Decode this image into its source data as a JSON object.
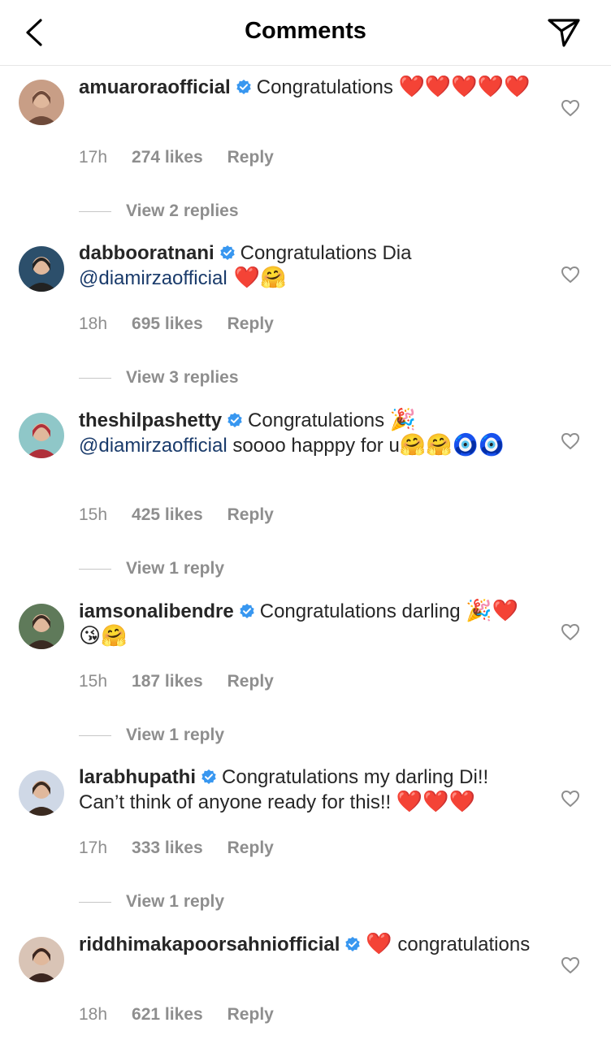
{
  "header": {
    "title": "Comments"
  },
  "comments": [
    {
      "username": "amuaroraofficial",
      "segments": [
        {
          "t": "text",
          "v": "Congratulations "
        },
        {
          "t": "emoji",
          "v": "❤️❤️❤️❤️❤️"
        }
      ],
      "time": "17h",
      "likes": "274 likes",
      "reply": "Reply",
      "view_replies": "View 2 replies",
      "avatar_colors": [
        "#c89e86",
        "#6e4a3a"
      ]
    },
    {
      "username": "dabbooratnani",
      "segments": [
        {
          "t": "text",
          "v": "Congratulations Dia "
        },
        {
          "t": "mention",
          "v": "@diamirzaofficial"
        },
        {
          "t": "emoji",
          "v": " ❤️🤗"
        }
      ],
      "time": "18h",
      "likes": "695 likes",
      "reply": "Reply",
      "view_replies": "View 3 replies",
      "avatar_colors": [
        "#2c4f6b",
        "#222222"
      ]
    },
    {
      "username": "theshilpashetty",
      "segments": [
        {
          "t": "text",
          "v": "Congratulations "
        },
        {
          "t": "emoji",
          "v": "🎉"
        },
        {
          "t": "text",
          "v": " "
        },
        {
          "t": "mention",
          "v": "@diamirzaofficial"
        },
        {
          "t": "text",
          "v": " soooo happpy for u"
        },
        {
          "t": "emoji",
          "v": "🤗🤗🧿🧿"
        }
      ],
      "time": "15h",
      "likes": "425 likes",
      "reply": "Reply",
      "view_replies": "View 1 reply",
      "avatar_colors": [
        "#8fc7c8",
        "#b0303a"
      ]
    },
    {
      "username": "iamsonalibendre",
      "segments": [
        {
          "t": "text",
          "v": "Congratulations darling "
        },
        {
          "t": "emoji",
          "v": "🎉❤️😘🤗"
        }
      ],
      "time": "15h",
      "likes": "187 likes",
      "reply": "Reply",
      "view_replies": "View 1 reply",
      "avatar_colors": [
        "#5f7a5a",
        "#3a2a22"
      ]
    },
    {
      "username": "larabhupathi",
      "segments": [
        {
          "t": "text",
          "v": "Congratulations my darling Di!! Can’t think of anyone ready for this!! "
        },
        {
          "t": "emoji",
          "v": "❤️❤️❤️"
        }
      ],
      "time": "17h",
      "likes": "333 likes",
      "reply": "Reply",
      "view_replies": "View 1 reply",
      "avatar_colors": [
        "#cfd8e6",
        "#3a2a20"
      ]
    },
    {
      "username": "riddhimakapoorsahniofficial",
      "segments": [
        {
          "t": "emoji",
          "v": "❤️"
        },
        {
          "t": "text",
          "v": " congratulations"
        }
      ],
      "time": "18h",
      "likes": "621 likes",
      "reply": "Reply",
      "view_replies": "",
      "avatar_colors": [
        "#d9c4b6",
        "#3b2620"
      ]
    }
  ],
  "colors": {
    "verified": "#3897f0",
    "meta_text": "#8e8e8e",
    "mention": "#1a3b6b"
  }
}
